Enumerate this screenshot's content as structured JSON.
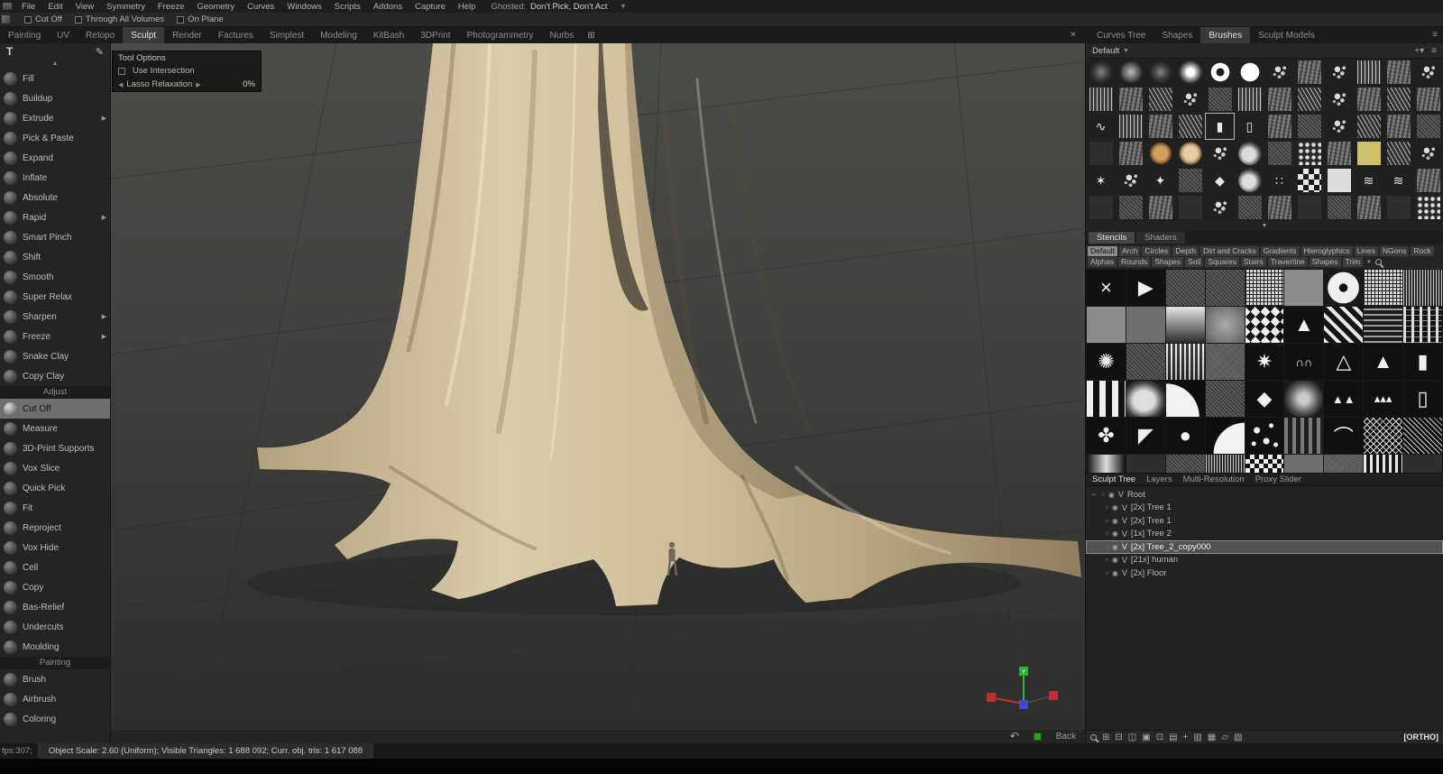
{
  "menu_bar": {
    "items": [
      "File",
      "Edit",
      "View",
      "Symmetry",
      "Freeze",
      "Geometry",
      "Curves",
      "Windows",
      "Scripts",
      "Addons",
      "Capture",
      "Help"
    ],
    "ghosted_label": "Ghosted:",
    "ghosted_value": "Don't Pick, Don't Act"
  },
  "toolbar": {
    "checkboxes": [
      "Cut Off",
      "Through All Volumes",
      "On Plane"
    ]
  },
  "workspace_tabs": {
    "items": [
      "Painting",
      "UV",
      "Retopo",
      "Sculpt",
      "Render",
      "Factures",
      "Simplest",
      "Modeling",
      "KitBash",
      "3DPrint",
      "Photogrammetry",
      "Nurbs"
    ],
    "active": "Sculpt"
  },
  "left_tools": {
    "sections": [
      {
        "title": null,
        "items": [
          "Fill",
          "Buildup",
          "Extrude",
          "Pick & Paste",
          "Expand",
          "Inflate",
          "Absolute",
          "Rapid",
          "Smart Pinch",
          "Shift",
          "Smooth",
          "Super Relax",
          "Sharpen",
          "Freeze",
          "Snake Clay",
          "Copy Clay"
        ]
      },
      {
        "title": "Adjust",
        "items": [
          "Cut Off",
          "Measure",
          "3D-Print Supports",
          "Vox Slice",
          "Quick Pick",
          "Fit",
          "Reproject",
          "Vox Hide",
          "Cell",
          "Copy",
          "Bas-Relief",
          "Undercuts",
          "Moulding"
        ]
      },
      {
        "title": "Painting",
        "items": [
          "Brush",
          "Airbrush",
          "Coloring"
        ]
      }
    ],
    "active": "Cut Off",
    "with_arrow": [
      "Extrude",
      "Rapid",
      "Sharpen",
      "Freeze"
    ]
  },
  "tool_options": {
    "title": "Tool Options",
    "use_intersection": "Use Intersection",
    "lasso_relaxation": "Lasso Relaxation",
    "lasso_value": "0%"
  },
  "right_top_tabs": {
    "items": [
      "Curves Tree",
      "Shapes",
      "Brushes",
      "Sculpt Models"
    ],
    "active": "Brushes"
  },
  "brushes_panel": {
    "preset": "Default",
    "selected_index": 28,
    "cells": [
      "soft1",
      "soft2",
      "soft1",
      "soft3",
      "ring",
      "hard",
      "spl",
      "chip",
      "spl",
      "vstreak",
      "chip",
      "spl",
      "vstreak",
      "chip",
      "diag",
      "spl",
      "noise",
      "vstreak",
      "chip",
      "diag",
      "spl",
      "chip",
      "diag",
      "chip",
      "wire",
      "vstreak",
      "chip",
      "diag",
      "vbar",
      "vbar2",
      "chip",
      "noise",
      "spl",
      "diag",
      "chip",
      "noise",
      "dark",
      "chip",
      "clay",
      "clay2",
      "spl",
      "blob",
      "noise",
      "dots",
      "chip",
      "sqy",
      "diag",
      "spl",
      "star",
      "spl",
      "burst",
      "noise",
      "diamond",
      "blob",
      "dotgrid",
      "check",
      "sqw",
      "wave",
      "wave",
      "chip",
      "dark",
      "noise",
      "chip",
      "dark",
      "spl",
      "noise",
      "chip",
      "dark",
      "noise",
      "chip",
      "dark",
      "dots"
    ]
  },
  "stencils_panel": {
    "tabs": [
      "Stencils",
      "Shaders"
    ],
    "active_tab": "Stencils",
    "categories": [
      "Default",
      "Arch",
      "Circles",
      "Depth",
      "Dirt and Cracks",
      "Gradients",
      "Hieroglyphics",
      "Lines",
      "NGons",
      "Rock",
      "Alphas",
      "Rounds",
      "Shapes",
      "Soil",
      "Squares",
      "Stairs",
      "Travertine",
      "Shapes",
      "Trim"
    ],
    "active_category": "Default",
    "cells": [
      "x",
      "flag",
      "noise",
      "noise",
      "fgrid",
      "gray",
      "ringb",
      "fgrid",
      "vstripe",
      "gray",
      "gray2",
      "grad",
      "graysoft",
      "diamonds",
      "tri",
      "zig",
      "weave",
      "barsgrid",
      "mandala",
      "noise",
      "curtain",
      "noisefine",
      "star8",
      "arches",
      "triline",
      "cone",
      "pillar",
      "vbars3",
      "blob2",
      "quarter",
      "noise",
      "diamond",
      "blur",
      "trees",
      "cones",
      "pillar2",
      "ornament",
      "corner",
      "dotbig",
      "quarter2",
      "scatter",
      "vpat",
      "arcline",
      "crosshatch",
      "hatch",
      "gradband",
      "dark",
      "noise",
      "vstripe",
      "check2",
      "gray2",
      "noisefine",
      "vbars",
      "dark"
    ]
  },
  "sculpt_tree": {
    "tabs": [
      "Sculpt Tree",
      "Layers",
      "Multi-Resolution",
      "Proxy Slider"
    ],
    "active": "Sculpt Tree",
    "items": [
      {
        "label": "Root",
        "depth": 0,
        "selected": false,
        "expander": true
      },
      {
        "label": "[2x] Tree 1",
        "depth": 1,
        "selected": false,
        "expander": false
      },
      {
        "label": "[2x] Tree 1",
        "depth": 1,
        "selected": false,
        "expander": false
      },
      {
        "label": "[1x] Tree 2",
        "depth": 1,
        "selected": false,
        "expander": false
      },
      {
        "label": "[2x] Tree_2_copy000",
        "depth": 1,
        "selected": true,
        "expander": false
      },
      {
        "label": "[21x] human",
        "depth": 1,
        "selected": false,
        "expander": false
      },
      {
        "label": "[2x] Floor",
        "depth": 1,
        "selected": false,
        "expander": false
      }
    ],
    "visibility_flag": "V"
  },
  "viewport": {
    "back_label": "Back"
  },
  "rp_bottom": {
    "icons": [
      "magnifier",
      "grid-plus",
      "grid-minus",
      "panes",
      "filled-box",
      "dot-box",
      "rows",
      "plus",
      "cols",
      "grid",
      "page",
      "shade"
    ],
    "ortho_label": "[ORTHO]"
  },
  "status_bar": {
    "fps": "fps:307;",
    "info": "Object Scale: 2.60 (Uniform); Visible Triangles: 1 688 092; Curr. obj. tris: 1 617 088"
  }
}
